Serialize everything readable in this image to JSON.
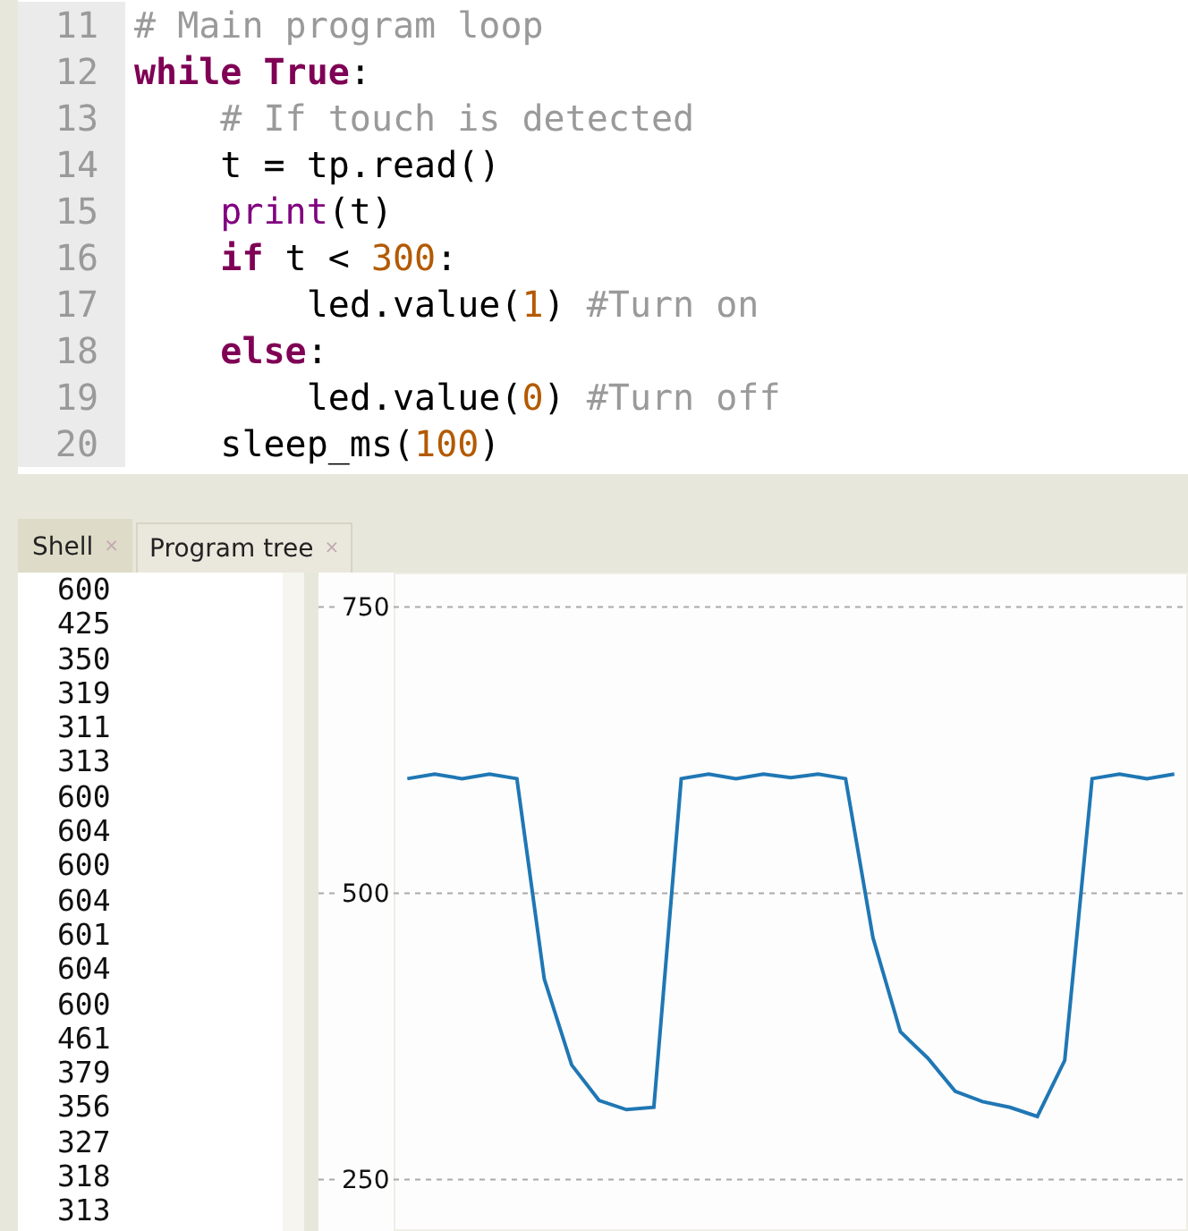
{
  "editor": {
    "lines": [
      {
        "number": "11",
        "tokens": [
          {
            "kind": "comment",
            "text": "# Main program loop"
          }
        ]
      },
      {
        "number": "12",
        "tokens": [
          {
            "kind": "keyword",
            "text": "while True"
          },
          {
            "kind": "plain",
            "text": ":"
          }
        ]
      },
      {
        "number": "13",
        "tokens": [
          {
            "kind": "comment",
            "text": "    # If touch is detected"
          }
        ]
      },
      {
        "number": "14",
        "tokens": [
          {
            "kind": "plain",
            "text": "    t = tp.read()"
          }
        ]
      },
      {
        "number": "15",
        "tokens": [
          {
            "kind": "builtin",
            "text": "    print"
          },
          {
            "kind": "plain",
            "text": "(t)"
          }
        ]
      },
      {
        "number": "16",
        "tokens": [
          {
            "kind": "keyword",
            "text": "    if"
          },
          {
            "kind": "plain",
            "text": " t < "
          },
          {
            "kind": "number",
            "text": "300"
          },
          {
            "kind": "plain",
            "text": ":"
          }
        ]
      },
      {
        "number": "17",
        "tokens": [
          {
            "kind": "plain",
            "text": "        led.value("
          },
          {
            "kind": "number",
            "text": "1"
          },
          {
            "kind": "plain",
            "text": ") "
          },
          {
            "kind": "comment",
            "text": "#Turn on"
          }
        ]
      },
      {
        "number": "18",
        "tokens": [
          {
            "kind": "keyword",
            "text": "    else"
          },
          {
            "kind": "plain",
            "text": ":"
          }
        ]
      },
      {
        "number": "19",
        "tokens": [
          {
            "kind": "plain",
            "text": "        led.value("
          },
          {
            "kind": "number",
            "text": "0"
          },
          {
            "kind": "plain",
            "text": ") "
          },
          {
            "kind": "comment",
            "text": "#Turn off"
          }
        ]
      },
      {
        "number": "20",
        "tokens": [
          {
            "kind": "plain",
            "text": "    sleep_ms("
          },
          {
            "kind": "number",
            "text": "100"
          },
          {
            "kind": "plain",
            "text": ")"
          }
        ]
      }
    ]
  },
  "tabs": [
    {
      "label": "Shell",
      "close": "×",
      "selected": true
    },
    {
      "label": "Program tree",
      "close": "×",
      "selected": false
    }
  ],
  "shell": {
    "lines": [
      "600",
      "425",
      "350",
      "319",
      "311",
      "313",
      "600",
      "604",
      "600",
      "604",
      "601",
      "604",
      "600",
      "461",
      "379",
      "356",
      "327",
      "318",
      "313"
    ]
  },
  "plotter": {
    "chart_data": {
      "type": "line",
      "categories": [
        null,
        null,
        null,
        null,
        null,
        null,
        null,
        null,
        null,
        null,
        null,
        null,
        null,
        null,
        null,
        null,
        null,
        null,
        null,
        null,
        null,
        null,
        null,
        null,
        null,
        null,
        null,
        null,
        null
      ],
      "series": [
        {
          "color": "#1f77b4",
          "values": [
            600,
            604,
            600,
            604,
            600,
            425,
            350,
            319,
            311,
            313,
            600,
            604,
            600,
            604,
            601,
            604,
            600,
            461,
            379,
            356,
            327,
            318,
            313,
            305,
            354,
            600,
            604,
            600,
            604
          ]
        }
      ],
      "ylim": [
        205,
        780
      ],
      "yticks": [
        250,
        500,
        750
      ],
      "grid": true
    }
  }
}
